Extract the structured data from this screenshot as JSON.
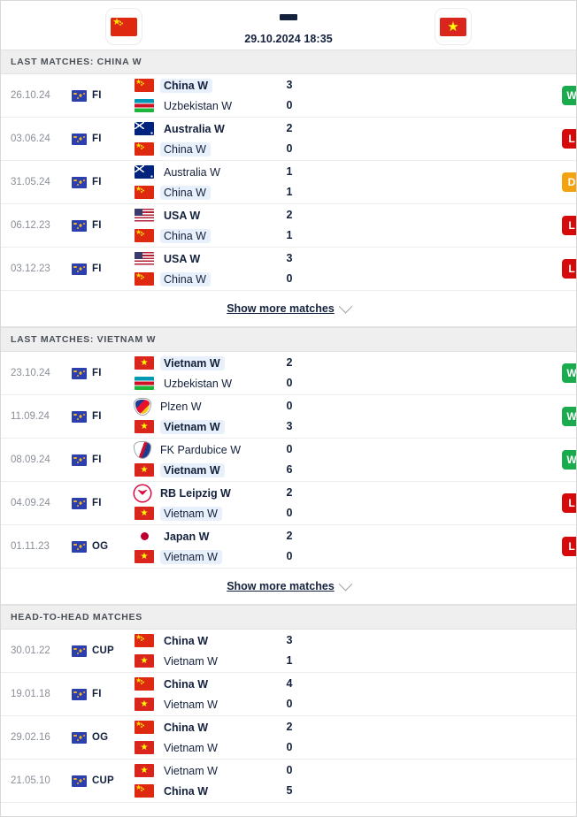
{
  "header": {
    "home_team": "China W",
    "home_flag": "flag-cn",
    "away_team": "Vietnam W",
    "away_flag": "flag-vn",
    "score_separator": "-",
    "kickoff": "29.10.2024 18:35"
  },
  "sections": [
    {
      "title": "LAST MATCHES: CHINA W",
      "show_more_label": "Show more matches",
      "has_show_more": true,
      "matches": [
        {
          "date": "26.10.24",
          "competition": "FI",
          "home": {
            "name": "China W",
            "flag": "flag-cn",
            "kind": "flag",
            "winner": true,
            "featured": true
          },
          "away": {
            "name": "Uzbekistan W",
            "flag": "flag-uz",
            "kind": "flag",
            "winner": false,
            "featured": false
          },
          "home_score": "3",
          "away_score": "0",
          "result": "W"
        },
        {
          "date": "03.06.24",
          "competition": "FI",
          "home": {
            "name": "Australia W",
            "flag": "flag-au",
            "kind": "flag",
            "winner": true,
            "featured": false
          },
          "away": {
            "name": "China W",
            "flag": "flag-cn",
            "kind": "flag",
            "winner": false,
            "featured": true
          },
          "home_score": "2",
          "away_score": "0",
          "result": "L"
        },
        {
          "date": "31.05.24",
          "competition": "FI",
          "home": {
            "name": "Australia W",
            "flag": "flag-au",
            "kind": "flag",
            "winner": false,
            "featured": false
          },
          "away": {
            "name": "China W",
            "flag": "flag-cn",
            "kind": "flag",
            "winner": false,
            "featured": true
          },
          "home_score": "1",
          "away_score": "1",
          "result": "D"
        },
        {
          "date": "06.12.23",
          "competition": "FI",
          "home": {
            "name": "USA W",
            "flag": "flag-us",
            "kind": "flag",
            "winner": true,
            "featured": false
          },
          "away": {
            "name": "China W",
            "flag": "flag-cn",
            "kind": "flag",
            "winner": false,
            "featured": true
          },
          "home_score": "2",
          "away_score": "1",
          "result": "L"
        },
        {
          "date": "03.12.23",
          "competition": "FI",
          "home": {
            "name": "USA W",
            "flag": "flag-us",
            "kind": "flag",
            "winner": true,
            "featured": false
          },
          "away": {
            "name": "China W",
            "flag": "flag-cn",
            "kind": "flag",
            "winner": false,
            "featured": true
          },
          "home_score": "3",
          "away_score": "0",
          "result": "L"
        }
      ]
    },
    {
      "title": "LAST MATCHES: VIETNAM W",
      "show_more_label": "Show more matches",
      "has_show_more": true,
      "matches": [
        {
          "date": "23.10.24",
          "competition": "FI",
          "home": {
            "name": "Vietnam W",
            "flag": "flag-vn",
            "kind": "flag",
            "winner": true,
            "featured": true
          },
          "away": {
            "name": "Uzbekistan W",
            "flag": "flag-uz",
            "kind": "flag",
            "winner": false,
            "featured": false
          },
          "home_score": "2",
          "away_score": "0",
          "result": "W"
        },
        {
          "date": "11.09.24",
          "competition": "FI",
          "home": {
            "name": "Plzen W",
            "flag": "crest-plzen",
            "kind": "crest",
            "winner": false,
            "featured": false
          },
          "away": {
            "name": "Vietnam W",
            "flag": "flag-vn",
            "kind": "flag",
            "winner": true,
            "featured": true
          },
          "home_score": "0",
          "away_score": "3",
          "result": "W"
        },
        {
          "date": "08.09.24",
          "competition": "FI",
          "home": {
            "name": "FK Pardubice W",
            "flag": "crest-pardubice",
            "kind": "crest",
            "winner": false,
            "featured": false
          },
          "away": {
            "name": "Vietnam W",
            "flag": "flag-vn",
            "kind": "flag",
            "winner": true,
            "featured": true
          },
          "home_score": "0",
          "away_score": "6",
          "result": "W"
        },
        {
          "date": "04.09.24",
          "competition": "FI",
          "home": {
            "name": "RB Leipzig W",
            "flag": "crest-leipzig",
            "kind": "crest",
            "winner": true,
            "featured": false
          },
          "away": {
            "name": "Vietnam W",
            "flag": "flag-vn",
            "kind": "flag",
            "winner": false,
            "featured": true
          },
          "home_score": "2",
          "away_score": "0",
          "result": "L"
        },
        {
          "date": "01.11.23",
          "competition": "OG",
          "home": {
            "name": "Japan W",
            "flag": "flag-jp",
            "kind": "flag",
            "winner": true,
            "featured": false
          },
          "away": {
            "name": "Vietnam W",
            "flag": "flag-vn",
            "kind": "flag",
            "winner": false,
            "featured": true
          },
          "home_score": "2",
          "away_score": "0",
          "result": "L"
        }
      ]
    },
    {
      "title": "HEAD-TO-HEAD MATCHES",
      "show_more_label": "",
      "has_show_more": false,
      "matches": [
        {
          "date": "30.01.22",
          "competition": "CUP",
          "home": {
            "name": "China W",
            "flag": "flag-cn",
            "kind": "flag",
            "winner": true,
            "featured": false
          },
          "away": {
            "name": "Vietnam W",
            "flag": "flag-vn",
            "kind": "flag",
            "winner": false,
            "featured": false
          },
          "home_score": "3",
          "away_score": "1",
          "result": ""
        },
        {
          "date": "19.01.18",
          "competition": "FI",
          "home": {
            "name": "China W",
            "flag": "flag-cn",
            "kind": "flag",
            "winner": true,
            "featured": false
          },
          "away": {
            "name": "Vietnam W",
            "flag": "flag-vn",
            "kind": "flag",
            "winner": false,
            "featured": false
          },
          "home_score": "4",
          "away_score": "0",
          "result": ""
        },
        {
          "date": "29.02.16",
          "competition": "OG",
          "home": {
            "name": "China W",
            "flag": "flag-cn",
            "kind": "flag",
            "winner": true,
            "featured": false
          },
          "away": {
            "name": "Vietnam W",
            "flag": "flag-vn",
            "kind": "flag",
            "winner": false,
            "featured": false
          },
          "home_score": "2",
          "away_score": "0",
          "result": ""
        },
        {
          "date": "21.05.10",
          "competition": "CUP",
          "home": {
            "name": "Vietnam W",
            "flag": "flag-vn",
            "kind": "flag",
            "winner": false,
            "featured": false
          },
          "away": {
            "name": "China W",
            "flag": "flag-cn",
            "kind": "flag",
            "winner": true,
            "featured": false
          },
          "home_score": "0",
          "away_score": "5",
          "result": ""
        }
      ]
    }
  ]
}
